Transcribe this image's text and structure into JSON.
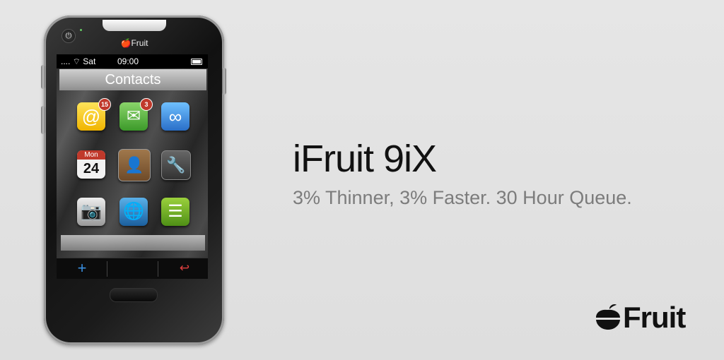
{
  "phone": {
    "brand_label": "Fruit",
    "status_bar": {
      "signal_label": ".... ⌔ Sat",
      "time": "09:00"
    },
    "screen_title": "Contacts",
    "apps": [
      {
        "name": "mail-icon",
        "badge": "15",
        "glyph": "@"
      },
      {
        "name": "messages-icon",
        "badge": "3",
        "glyph": "✉"
      },
      {
        "name": "sync-icon",
        "glyph": "∞"
      },
      {
        "name": "calendar-icon",
        "day": "Mon",
        "date": "24"
      },
      {
        "name": "contacts-icon",
        "glyph": "👤"
      },
      {
        "name": "settings-icon",
        "glyph": "🔧"
      },
      {
        "name": "camera-icon",
        "glyph": "📷"
      },
      {
        "name": "globe-icon",
        "glyph": "🌐"
      },
      {
        "name": "notes-icon",
        "glyph": "☰"
      }
    ],
    "bottom_bar": {
      "add_glyph": "+",
      "back_glyph": "↩"
    }
  },
  "ad": {
    "title": "iFruit 9iX",
    "tagline": "3% Thinner, 3% Faster. 30 Hour Queue.",
    "logo_text": "Fruit"
  },
  "colors": {
    "title": "#111111",
    "tagline": "#7c7c7c",
    "background": "#e3e3e3"
  }
}
